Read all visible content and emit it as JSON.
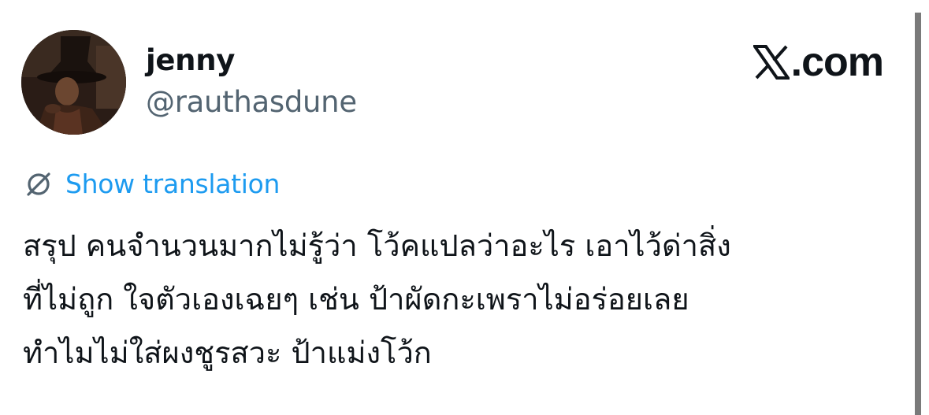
{
  "author": {
    "display_name": "jenny",
    "handle": "@rauthasdune",
    "avatar_icon": "profile-photo"
  },
  "brand": {
    "x_icon": "x-logo-icon",
    "text": ".com"
  },
  "translation": {
    "icon": "globe-translate-icon",
    "label": "Show translation",
    "color": "#1d9bf0"
  },
  "tweet": {
    "lines": [
      "สรุป คนจำนวนมากไม่รู้ว่า โว้คแปลว่าอะไร เอาไว้ด่าสิ่ง",
      "ที่ไม่ถูก ใจตัวเองเฉยๆ เช่น ป้าผัดกะเพราไม่อร่อยเลย",
      "ทำไมไม่ใส่ผงชูรสวะ ป้าแม่งโว้ก"
    ]
  },
  "colors": {
    "text": "#0f1419",
    "secondary": "#536471",
    "accent": "#1d9bf0"
  }
}
